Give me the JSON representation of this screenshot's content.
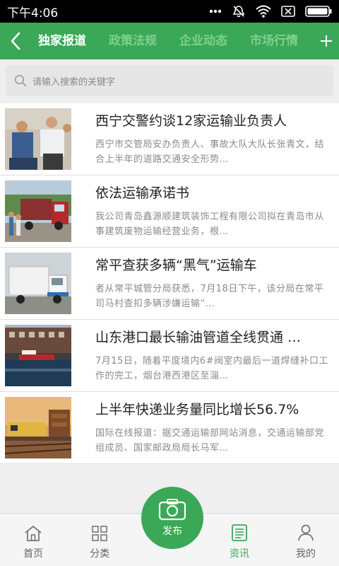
{
  "status_bar": {
    "time": "下午4:06",
    "icons": [
      "dots-icon",
      "mute-icon",
      "wifi-icon",
      "sim-icon",
      "battery-icon"
    ]
  },
  "nav": {
    "tabs": [
      {
        "label": "独家报道",
        "active": true
      },
      {
        "label": "政策法规"
      },
      {
        "label": "企业动态"
      },
      {
        "label": "市场行情"
      }
    ]
  },
  "search": {
    "placeholder": "请输入搜索的关键字"
  },
  "news": [
    {
      "title": "西宁交警约谈12家运输业负责人",
      "summary": "西宁市交管局安办负责人、事故大队大队长张青文，结合上半年的道路交通安全形势…",
      "thumb": "meeting"
    },
    {
      "title": "依法运输承诺书",
      "summary": "我公司青岛鑫源顺建筑装饰工程有限公司拟在青岛市从事建筑废物运输经营业务，根…",
      "thumb": "truck-red"
    },
    {
      "title": "常平查获多辆“黑气”运输车",
      "summary": "者从常平城管分局获悉，7月18日下午，该分局在常平司马村查扣多辆涉嫌运输“…",
      "thumb": "truck-white"
    },
    {
      "title": "山东港口最长输油管道全线贯通 …",
      "summary": "7月15日，随着平度境内6#阀室内最后一道焊缝补口工作的完工，烟台港西港区至淄…",
      "thumb": "port"
    },
    {
      "title": "上半年快递业务量同比增长56.7%",
      "summary": "国际在线报道：据交通运输部网站消息，交通运输部党组成员、国家邮政局局长马军…",
      "thumb": "train"
    }
  ],
  "bottom_nav": {
    "items": [
      {
        "label": "首页",
        "icon": "home-icon"
      },
      {
        "label": "分类",
        "icon": "grid-icon"
      },
      {
        "label": "资讯",
        "icon": "news-icon",
        "active": true
      },
      {
        "label": "我的",
        "icon": "user-icon"
      }
    ],
    "publish": {
      "label": "发布",
      "icon": "camera-icon"
    }
  },
  "colors": {
    "brand": "#3aa856",
    "tab_inactive": "#7fd08f",
    "summary": "#8a8a8a"
  }
}
